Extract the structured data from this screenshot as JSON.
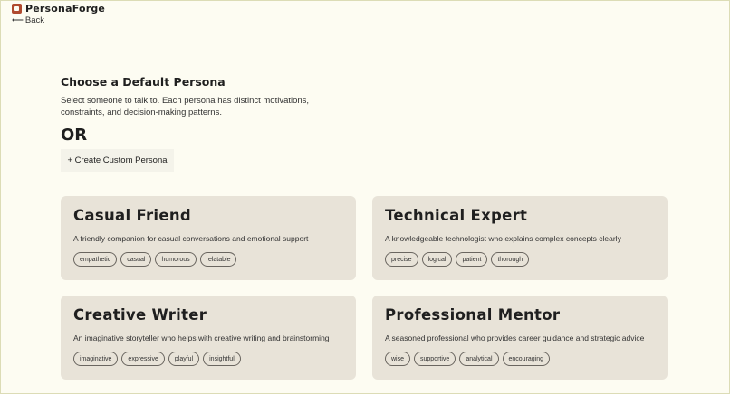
{
  "app": {
    "brand": "PersonaForge",
    "back_arrow": "⟵",
    "back_label": "Back"
  },
  "main": {
    "heading": "Choose a Default Persona",
    "subheading": "Select someone to talk to. Each persona has distinct motivations, constraints, and decision-making patterns.",
    "or_label": "OR",
    "create_button": "+ Create Custom Persona"
  },
  "personas": [
    {
      "name": "Casual Friend",
      "description": "A friendly companion for casual conversations and emotional support",
      "tags": [
        "empathetic",
        "casual",
        "humorous",
        "relatable"
      ]
    },
    {
      "name": "Technical Expert",
      "description": "A knowledgeable technologist who explains complex concepts clearly",
      "tags": [
        "precise",
        "logical",
        "patient",
        "thorough"
      ]
    },
    {
      "name": "Creative Writer",
      "description": "An imaginative storyteller who helps with creative writing and brainstorming",
      "tags": [
        "imaginative",
        "expressive",
        "playful",
        "insightful"
      ]
    },
    {
      "name": "Professional Mentor",
      "description": "A seasoned professional who provides career guidance and strategic advice",
      "tags": [
        "wise",
        "supportive",
        "analytical",
        "encouraging"
      ]
    }
  ],
  "colors": {
    "background": "#fdfcf2",
    "card": "#e8e3d8",
    "button": "#f4f3ea",
    "logo": "#b04a2e"
  },
  "icons": {
    "logo": "persona-logo-icon",
    "back": "arrow-left-icon"
  }
}
